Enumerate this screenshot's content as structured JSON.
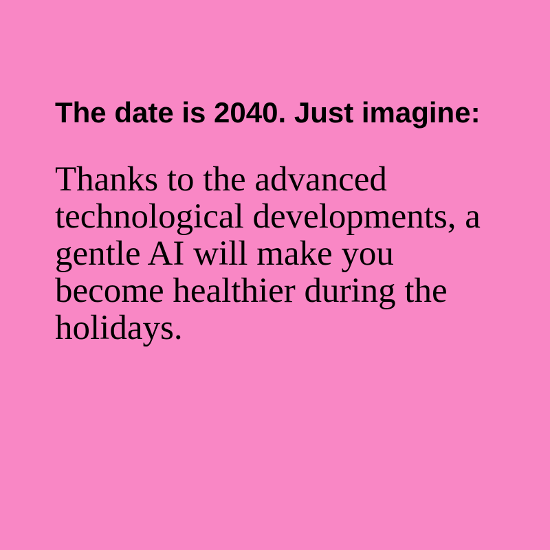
{
  "page": {
    "background_color": "#f987c5",
    "text_color": "#000000"
  },
  "content": {
    "headline": "The date is 2040. Just imagine:",
    "body": "Thanks to the advanced technological developments, a gentle AI will make you become healthier during the holidays."
  }
}
